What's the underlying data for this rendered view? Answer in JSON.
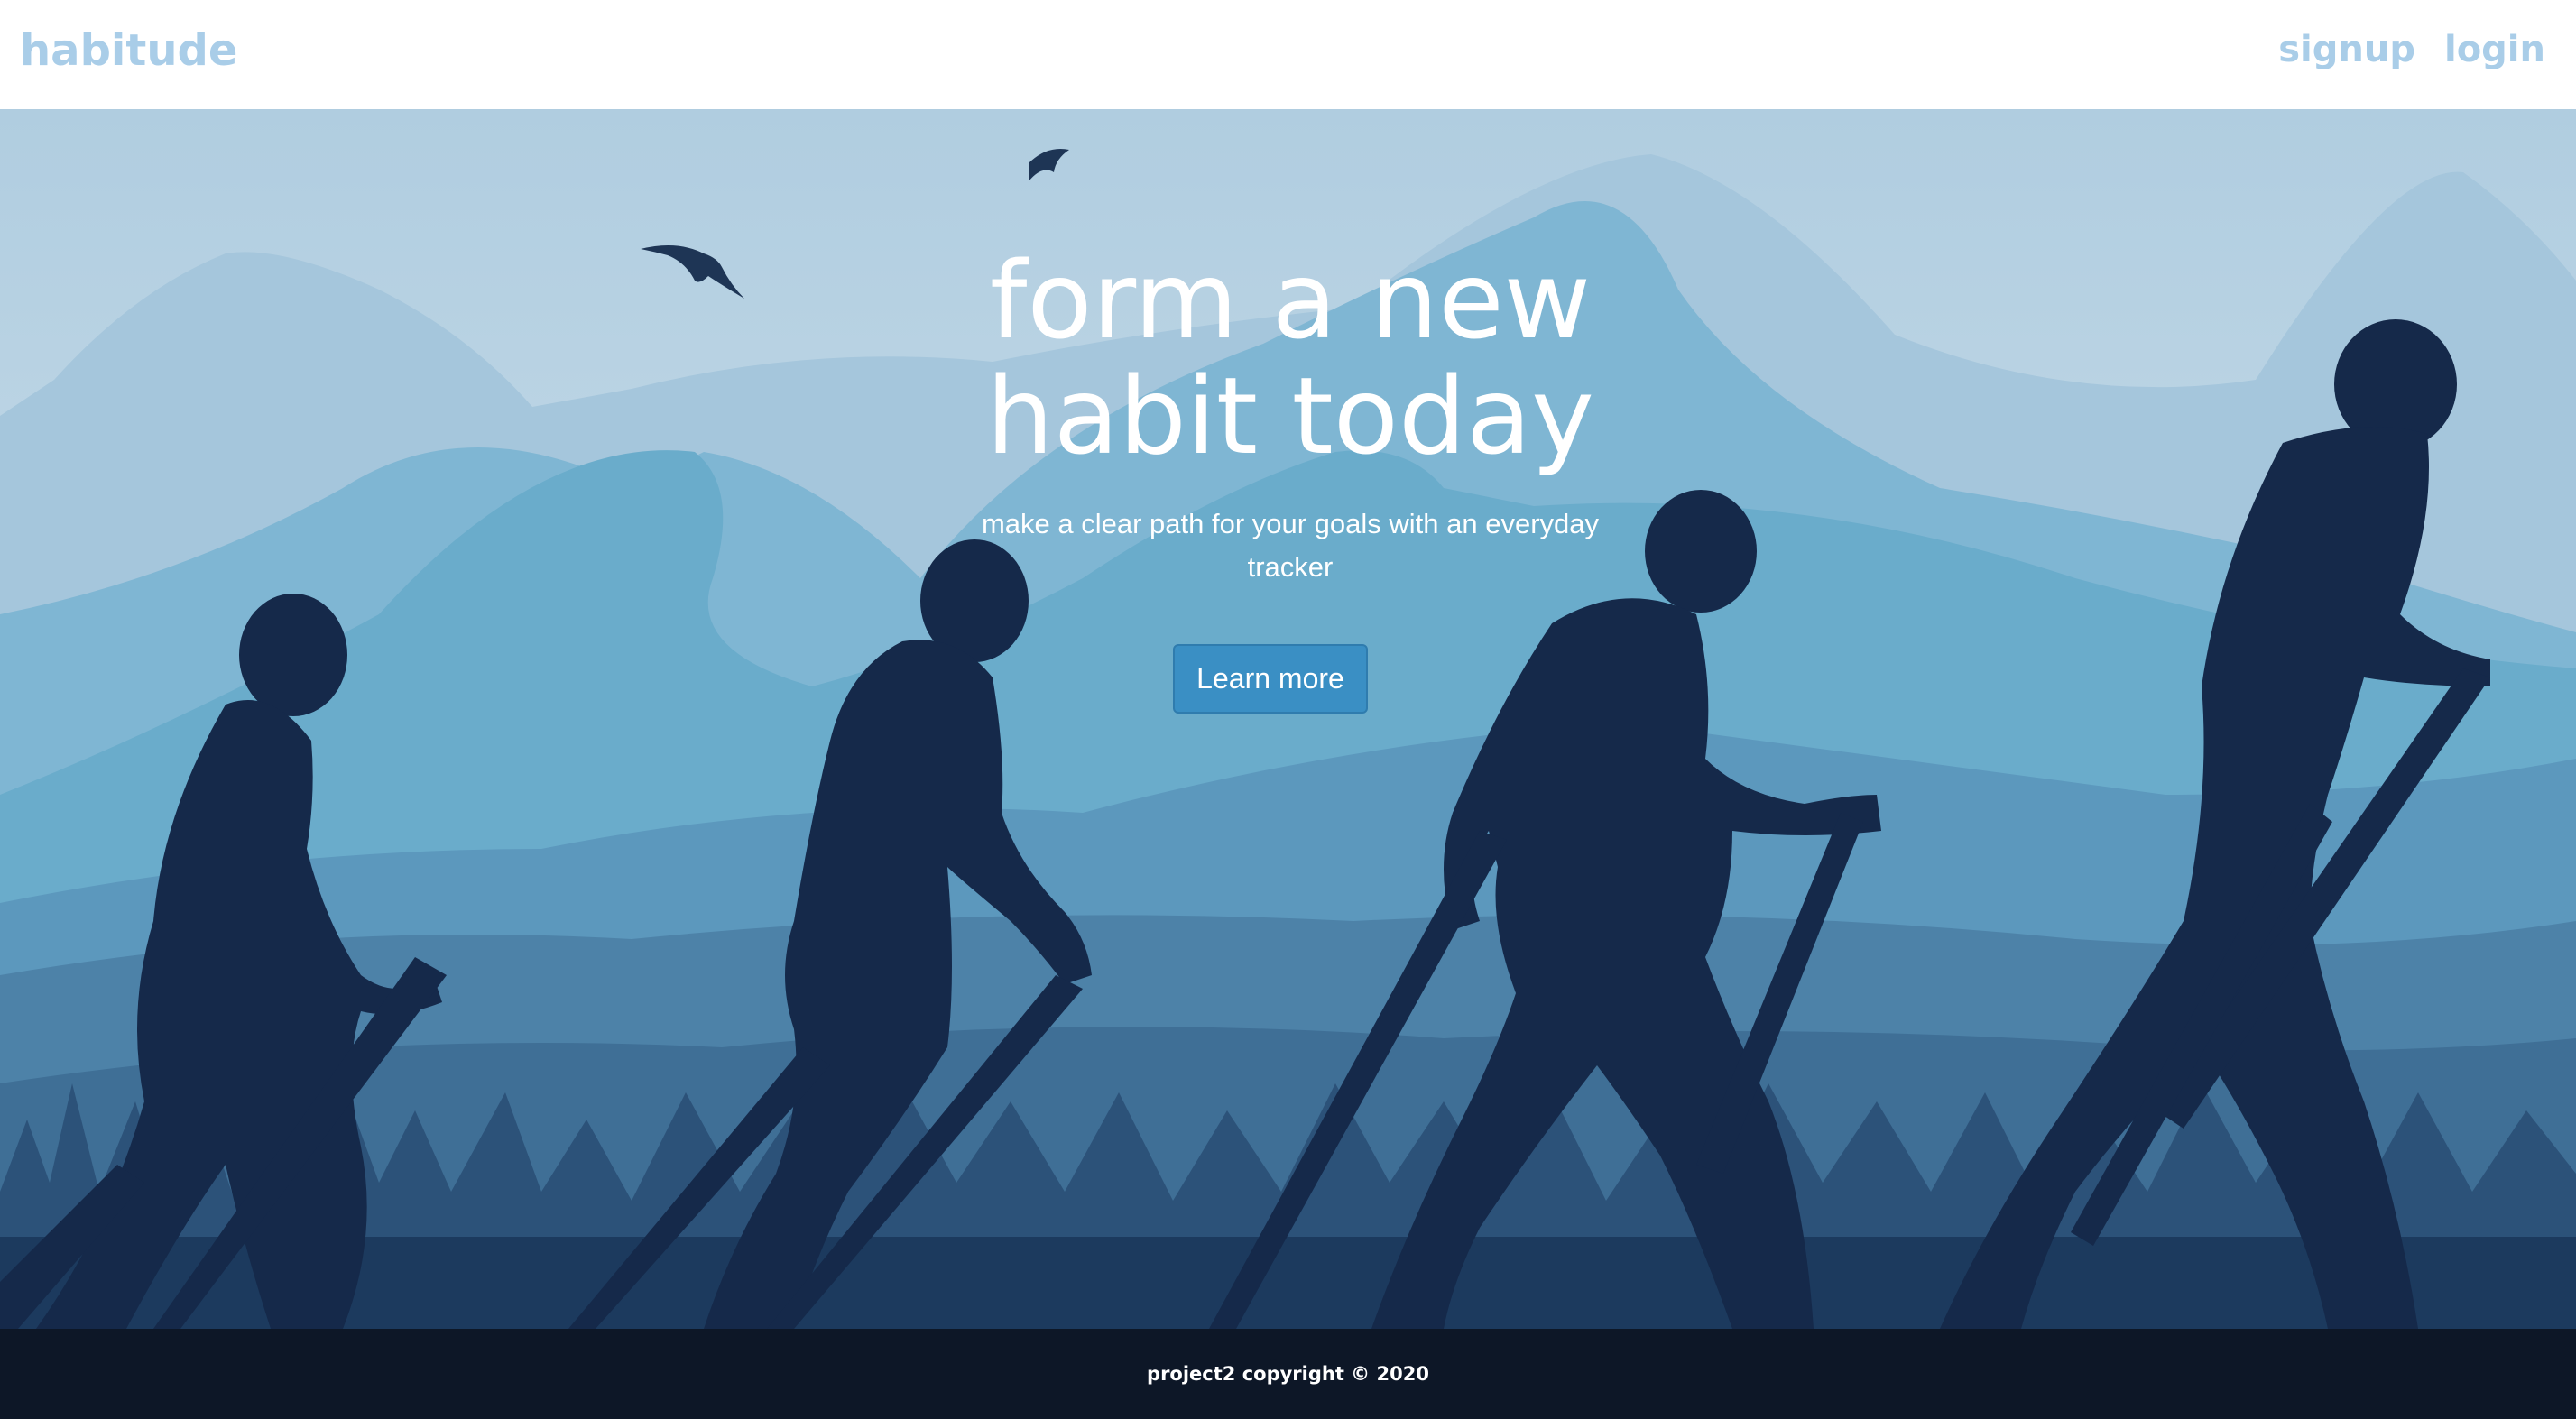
{
  "navbar": {
    "brand": "habitude",
    "links": [
      {
        "label": "signup"
      },
      {
        "label": "login"
      }
    ]
  },
  "hero": {
    "title_line1": "form a new",
    "title_line2": "habit today",
    "subtitle": "make a clear path for your goals with an everyday tracker",
    "cta_label": "Learn more"
  },
  "footer": {
    "text": "project2 copyright © 2020"
  },
  "colors": {
    "brand": "#a9cde8",
    "button": "#3a8fc4",
    "footer_bg": "#0d1727",
    "silhouette": "#15294a"
  }
}
